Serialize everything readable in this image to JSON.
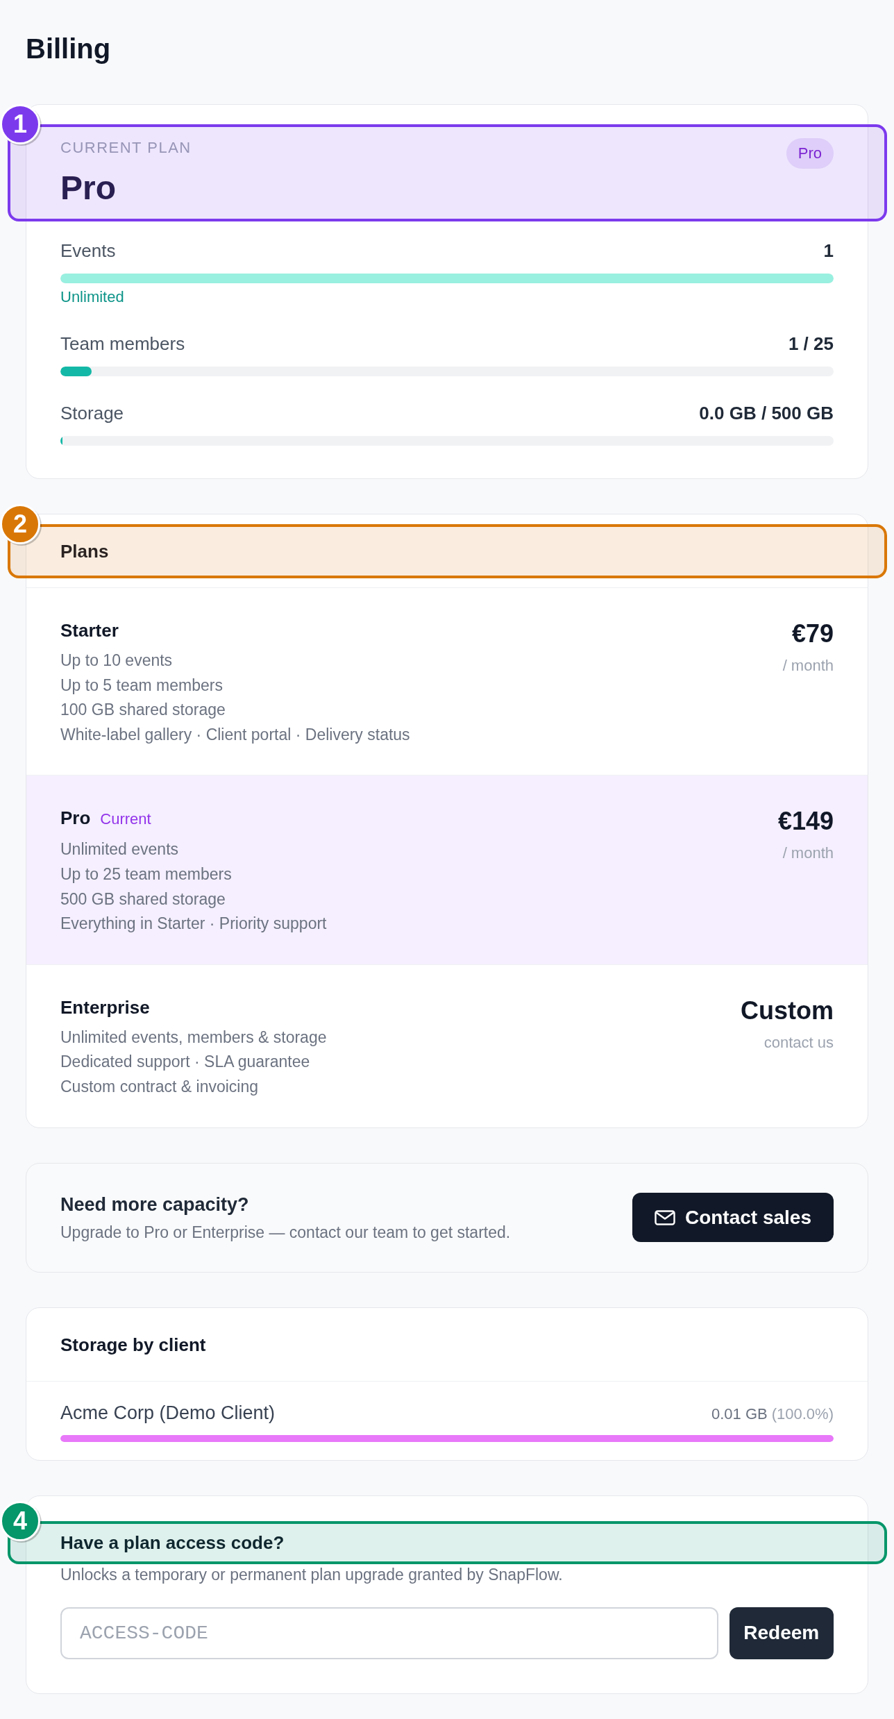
{
  "page": {
    "title": "Billing"
  },
  "current_plan": {
    "label": "CURRENT PLAN",
    "name": "Pro",
    "badge": "Pro",
    "annotation": {
      "number": "1",
      "color": "#7c3aed"
    },
    "usage": [
      {
        "kind": "unlimited",
        "label": "Events",
        "value": "1",
        "level": 1,
        "note": "Unlimited"
      },
      {
        "kind": "meter",
        "label": "Team members",
        "value": "1 / 25",
        "level": 0.04
      },
      {
        "kind": "meter",
        "label": "Storage",
        "value": "0.0 GB / 500 GB",
        "level": 0
      }
    ]
  },
  "plans": {
    "title": "Plans",
    "annotation": {
      "number": "2",
      "color": "#d97706"
    },
    "items": [
      {
        "name": "Starter",
        "current": false,
        "features": [
          "Up to 10 events",
          "Up to 5 team members",
          "100 GB shared storage",
          "White-label gallery · Client portal · Delivery status"
        ],
        "price": "€79",
        "period": "/ month"
      },
      {
        "name": "Pro",
        "current": true,
        "tag": "Current",
        "features": [
          "Unlimited events",
          "Up to 25 team members",
          "500 GB shared storage",
          "Everything in Starter · Priority support"
        ],
        "price": "€149",
        "period": "/ month"
      },
      {
        "name": "Enterprise",
        "current": false,
        "features": [
          "Unlimited events, members & storage",
          "Dedicated support · SLA guarantee",
          "Custom contract & invoicing"
        ],
        "price": "Custom",
        "period": "contact us"
      }
    ]
  },
  "capacity": {
    "title": "Need more capacity?",
    "text": "Upgrade to Pro or Enterprise — contact our team to get started.",
    "button": "Contact sales"
  },
  "storage_by_client": {
    "title": "Storage by client",
    "clients": [
      {
        "name": "Acme Corp (Demo Client)",
        "amount": "0.01 GB",
        "share": "(100.0%)",
        "level": 1,
        "color": "#e879f9"
      }
    ]
  },
  "access_code": {
    "title": "Have a plan access code?",
    "text": "Unlocks a temporary or permanent plan upgrade granted by SnapFlow.",
    "placeholder": "ACCESS-CODE",
    "button": "Redeem",
    "annotation": {
      "number": "4",
      "color": "#059669"
    }
  }
}
